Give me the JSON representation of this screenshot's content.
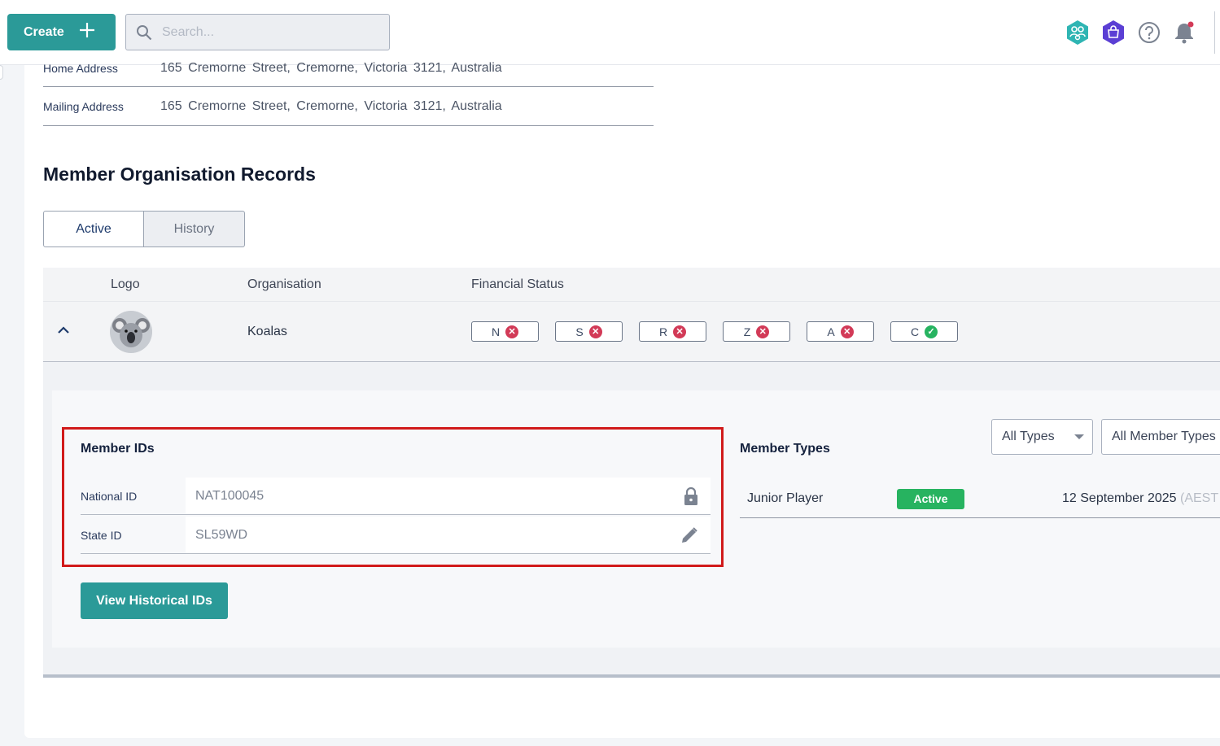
{
  "header": {
    "create_label": "Create",
    "search_placeholder": "Search..."
  },
  "address": {
    "rows": [
      {
        "label": "Home Address",
        "value": "165 Cremorne Street,   Cremorne,   Victoria  3121,   Australia"
      },
      {
        "label": "Mailing Address",
        "value": "165 Cremorne Street,   Cremorne,   Victoria  3121,   Australia"
      }
    ]
  },
  "section": {
    "title": "Member Organisation Records",
    "tabs": [
      {
        "label": "Active"
      },
      {
        "label": "History"
      }
    ]
  },
  "org_table": {
    "headers": {
      "logo": "Logo",
      "organisation": "Organisation",
      "financial_status": "Financial Status"
    },
    "row": {
      "organisation": "Koalas",
      "statuses": [
        {
          "code": "N",
          "status": "unfinancial"
        },
        {
          "code": "S",
          "status": "unfinancial"
        },
        {
          "code": "R",
          "status": "unfinancial"
        },
        {
          "code": "Z",
          "status": "unfinancial"
        },
        {
          "code": "A",
          "status": "unfinancial"
        },
        {
          "code": "C",
          "status": "financial"
        }
      ]
    }
  },
  "member_ids": {
    "title": "Member IDs",
    "national_label": "National ID",
    "national_value": "NAT100045",
    "state_label": "State ID",
    "state_value": "SL59WD",
    "history_button": "View Historical IDs"
  },
  "member_types": {
    "title": "Member Types",
    "filter_type": "All Types",
    "filter_member_type": "All Member Types",
    "rows": [
      {
        "name": "Junior Player",
        "status": "Active",
        "date": "12 September 2025",
        "tz": "(AEST"
      }
    ]
  },
  "colors": {
    "accent": "#2b9a98",
    "error": "#d23a57",
    "success": "#27b360",
    "highlight": "#d11a1a"
  }
}
